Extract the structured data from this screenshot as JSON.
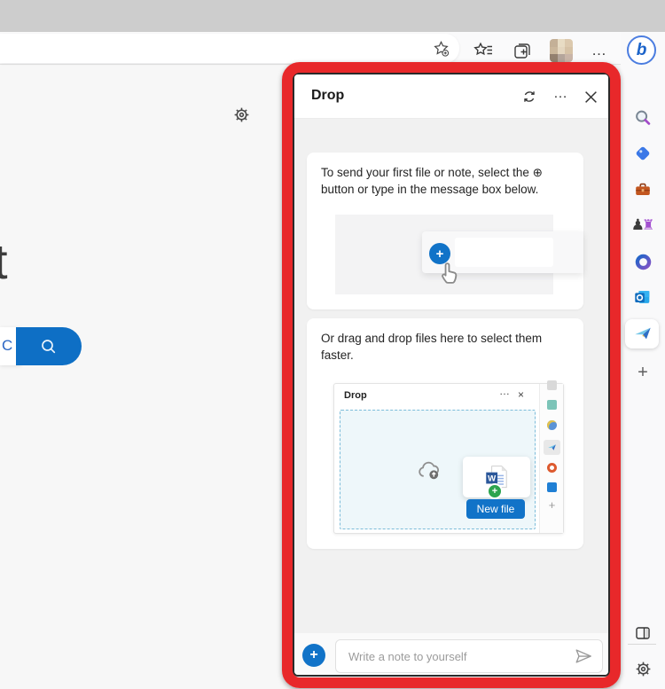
{
  "glyphs": {
    "plus": "+",
    "ellipsis": "…",
    "close": "×",
    "games_pawn": "♟",
    "games_rook": "♜",
    "bing_b": "b"
  },
  "browser": {
    "toolbar": {
      "more_glyph": "…"
    },
    "sidebar": {
      "active_item": "drop",
      "add_glyph": "+"
    }
  },
  "page": {
    "heading_fragment": "t",
    "search_text_fragment": "C"
  },
  "drop_panel": {
    "title": "Drop",
    "cards": [
      {
        "text": "To send your first file or note, select the ⊕ button or type in the message box below."
      },
      {
        "text": "Or drag and drop files here to select them faster."
      }
    ],
    "mini_window": {
      "title": "Drop",
      "new_file_label": "New file"
    },
    "composer": {
      "placeholder": "Write a note to yourself"
    }
  },
  "colors": {
    "accent_blue": "#1173c8",
    "highlight_red": "#e8282a",
    "green_badge": "#2ca44e",
    "word_blue": "#2b579a"
  }
}
